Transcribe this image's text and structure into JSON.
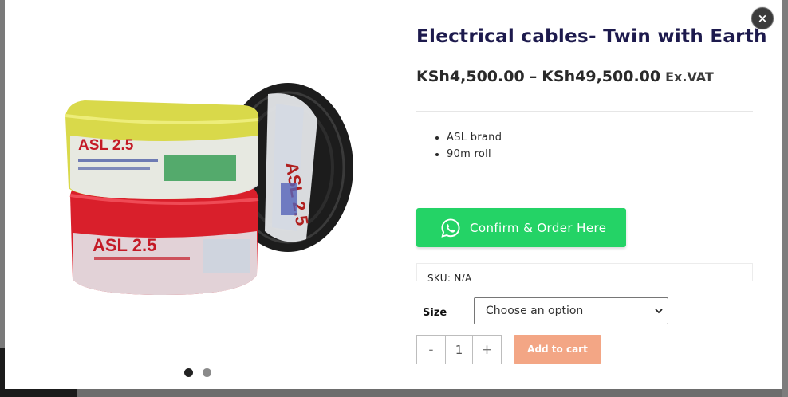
{
  "product": {
    "title": "Electrical cables- Twin with Earth",
    "price_min": "KSh4,500.00",
    "price_sep": "–",
    "price_max": "KSh49,500.00",
    "price_suffix": "Ex.VAT",
    "features": [
      "ASL brand",
      "90m roll"
    ],
    "sku_label": "SKU:",
    "sku_value": "N/A"
  },
  "image": {
    "labels": {
      "yellow_brand": "ASL 2.5",
      "red_brand": "ASL 2.5",
      "black_brand": "ASL 2.5"
    },
    "slide_count": 2,
    "active_slide": 1
  },
  "whatsapp": {
    "label": "Confirm & Order Here",
    "icon": "whatsapp-icon",
    "color": "#24d366"
  },
  "variation": {
    "label": "Size",
    "selected": "Choose an option"
  },
  "cart": {
    "minus": "-",
    "quantity": "1",
    "plus": "+",
    "add_label": "Add to cart",
    "button_color": "#f3a685"
  },
  "close": {
    "glyph": "×",
    "icon": "close-icon"
  },
  "colors": {
    "title": "#1d1a4d",
    "backdrop": "#6d6d6d"
  }
}
